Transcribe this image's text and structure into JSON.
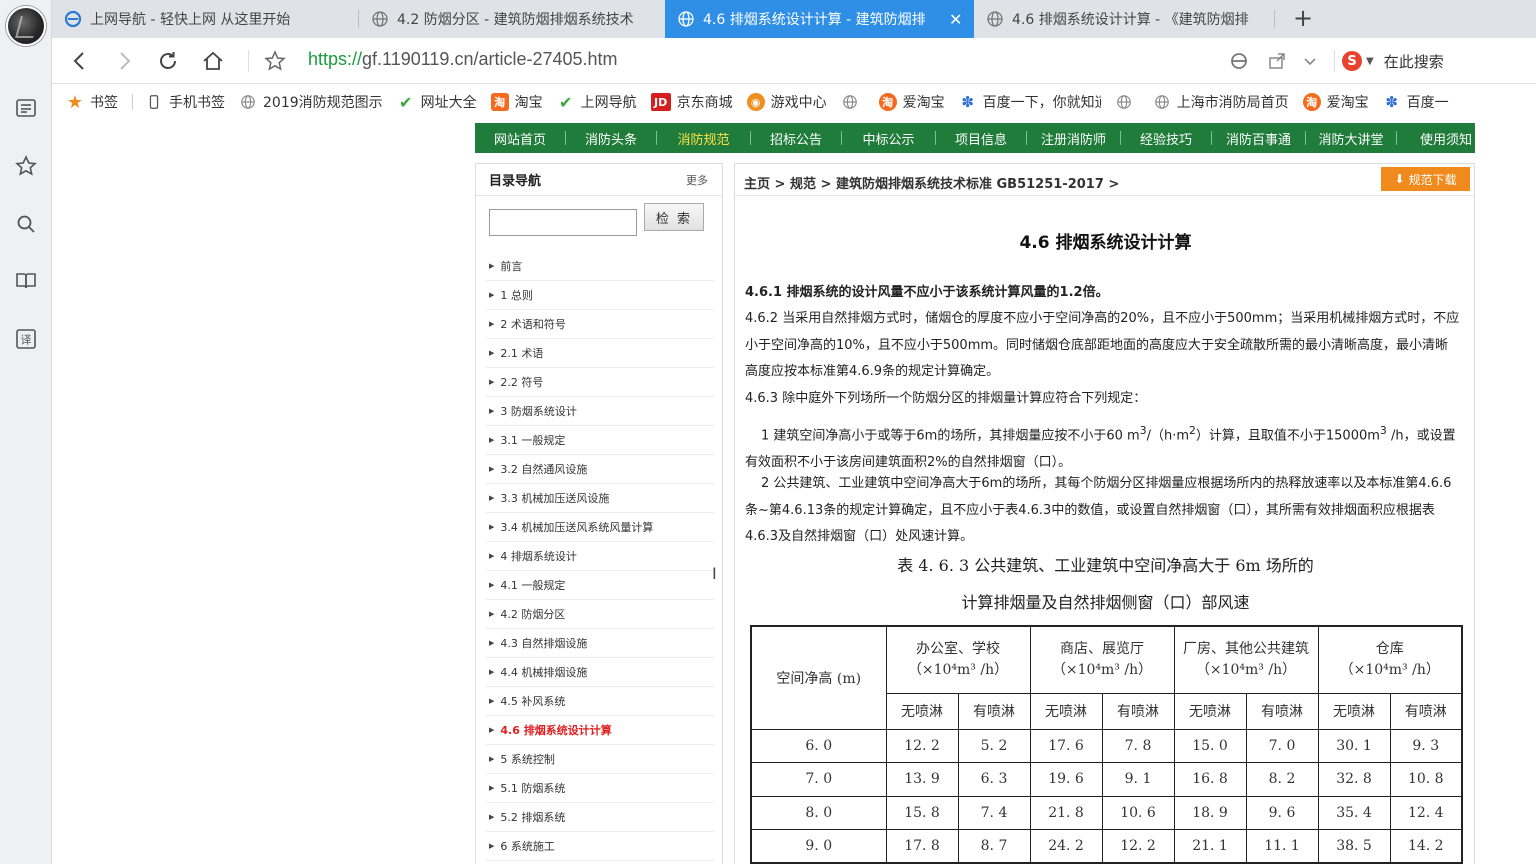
{
  "browser": {
    "tabs": [
      {
        "title": "上网导航 - 轻快上网 从这里开始",
        "icon": "ie-icon",
        "active": false
      },
      {
        "title": "4.2 防烟分区 - 建筑防烟排烟系统技术",
        "icon": "globe-icon",
        "active": false
      },
      {
        "title": "4.6 排烟系统设计计算 - 建筑防烟排",
        "icon": "globe-icon",
        "active": true
      },
      {
        "title": "4.6 排烟系统设计计算 - 《建筑防烟排",
        "icon": "globe-icon",
        "active": false
      }
    ],
    "new_tab_label": "+",
    "url_protocol": "https://",
    "url_rest": "gf.1190119.cn/article-27405.htm",
    "search_placeholder": "在此搜索",
    "search_engine_icon": "sogou-icon",
    "bookmarks": [
      {
        "label": "书签",
        "icon": "star-icon"
      },
      {
        "label": "手机书签",
        "icon": "phone-icon"
      },
      {
        "label": "2019消防规范图示",
        "icon": "globe-icon"
      },
      {
        "label": "网址大全",
        "icon": "check-icon"
      },
      {
        "label": "淘宝",
        "icon": "taobao-icon"
      },
      {
        "label": "上网导航",
        "icon": "check-icon"
      },
      {
        "label": "京东商城",
        "icon": "jd-icon"
      },
      {
        "label": "游戏中心",
        "icon": "game-icon"
      },
      {
        "label": "",
        "icon": "globe-icon"
      },
      {
        "label": "爱淘宝",
        "icon": "taobao-icon"
      },
      {
        "label": "百度一下，你就知道",
        "icon": "baidu-icon"
      },
      {
        "label": "",
        "icon": "globe-icon"
      },
      {
        "label": "上海市消防局首页",
        "icon": "globe-icon"
      },
      {
        "label": "爱淘宝",
        "icon": "taobao-icon"
      },
      {
        "label": "百度一",
        "icon": "baidu-icon"
      }
    ]
  },
  "site": {
    "nav": [
      "网站首页",
      "消防头条",
      "消防规范",
      "招标公告",
      "中标公示",
      "项目信息",
      "注册消防师",
      "经验技巧",
      "消防百事通",
      "消防大讲堂",
      "使用须知"
    ],
    "nav_active": "消防规范"
  },
  "sidebar": {
    "title": "目录导航",
    "more": "更多",
    "search_value": "",
    "search_button": "检 索",
    "items": [
      "前言",
      "1 总则",
      "2 术语和符号",
      "2.1 术语",
      "2.2 符号",
      "3 防烟系统设计",
      "3.1 一般规定",
      "3.2 自然通风设施",
      "3.3 机械加压送风设施",
      "3.4 机械加压送风系统风量计算",
      "4 排烟系统设计",
      "4.1 一般规定",
      "4.2 防烟分区",
      "4.3 自然排烟设施",
      "4.4 机械排烟设施",
      "4.5 补风系统",
      "4.6 排烟系统设计计算",
      "5 系统控制",
      "5.1 防烟系统",
      "5.2 排烟系统",
      "6 系统施工"
    ],
    "current": "4.6 排烟系统设计计算"
  },
  "article": {
    "breadcrumb": [
      "主页",
      "规范",
      "建筑防烟排烟系统技术标准 GB51251-2017"
    ],
    "breadcrumb_sep": ">",
    "download_button": "规范下载",
    "title": "4.6 排烟系统设计计算",
    "p1": "4.6.1 排烟系统的设计风量不应小于该系统计算风量的1.2倍。",
    "p2": "4.6.2 当采用自然排烟方式时，储烟仓的厚度不应小于空间净高的20%，且不应小于500mm；当采用机械排烟方式时，不应小于空间净高的10%，且不应小于500mm。同时储烟仓底部距地面的高度应大于安全疏散所需的最小清晰高度，最小清晰高度应按本标准第4.6.9条的规定计算确定。",
    "p3": "4.6.3 除中庭外下列场所一个防烟分区的排烟量计算应符合下列规定：",
    "p4_a": "1 建筑空间净高小于或等于6m的场所，其排烟量应按不小于60 m",
    "p4_b": "/（h·m",
    "p4_c": "）计算，且取值不小于15000m",
    "p4_d": " /h，或设置有效面积不小于该房间建筑面积2%的自然排烟窗（口）。",
    "p5": "2 公共建筑、工业建筑中空间净高大于6m的场所，其每个防烟分区排烟量应根据场所内的热释放速率以及本标准第4.6.6条~第4.6.13条的规定计算确定，且不应小于表4.6.3中的数值，或设置自然排烟窗（口），其所需有效排烟面积应根据表4.6.3及自然排烟窗（口）处风速计算。",
    "table_caption_1": "表 4. 6. 3 公共建筑、工业建筑中空间净高大于 6m 场所的",
    "table_caption_2": "计算排烟量及自然排烟侧窗（口）部风速"
  },
  "table": {
    "row_header": "空间净高 (m)",
    "groups": [
      {
        "name": "办公室、学校",
        "unit": "（×10⁴m³ /h）"
      },
      {
        "name": "商店、展览厅",
        "unit": "（×10⁴m³ /h）"
      },
      {
        "name": "厂房、其他公共建筑",
        "unit": "（×10⁴m³ /h）"
      },
      {
        "name": "仓库",
        "unit": "（×10⁴m³ /h）"
      }
    ],
    "sub": [
      "无喷淋",
      "有喷淋"
    ],
    "rows": [
      [
        "6. 0",
        "12. 2",
        "5. 2",
        "17. 6",
        "7. 8",
        "15. 0",
        "7. 0",
        "30. 1",
        "9. 3"
      ],
      [
        "7. 0",
        "13. 9",
        "6. 3",
        "19. 6",
        "9. 1",
        "16. 8",
        "8. 2",
        "32. 8",
        "10. 8"
      ],
      [
        "8. 0",
        "15. 8",
        "7. 4",
        "21. 8",
        "10. 6",
        "18. 9",
        "9. 6",
        "35. 4",
        "12. 4"
      ],
      [
        "9. 0",
        "17. 8",
        "8. 7",
        "24. 2",
        "12. 2",
        "21. 1",
        "11. 1",
        "38. 5",
        "14. 2"
      ]
    ]
  },
  "colors": {
    "tab_active": "#2f8fe6",
    "site_nav": "#1f7c3a",
    "nav_active_text": "#ffe24a",
    "download_button": "#f08a1c",
    "current_item": "#e02020"
  }
}
